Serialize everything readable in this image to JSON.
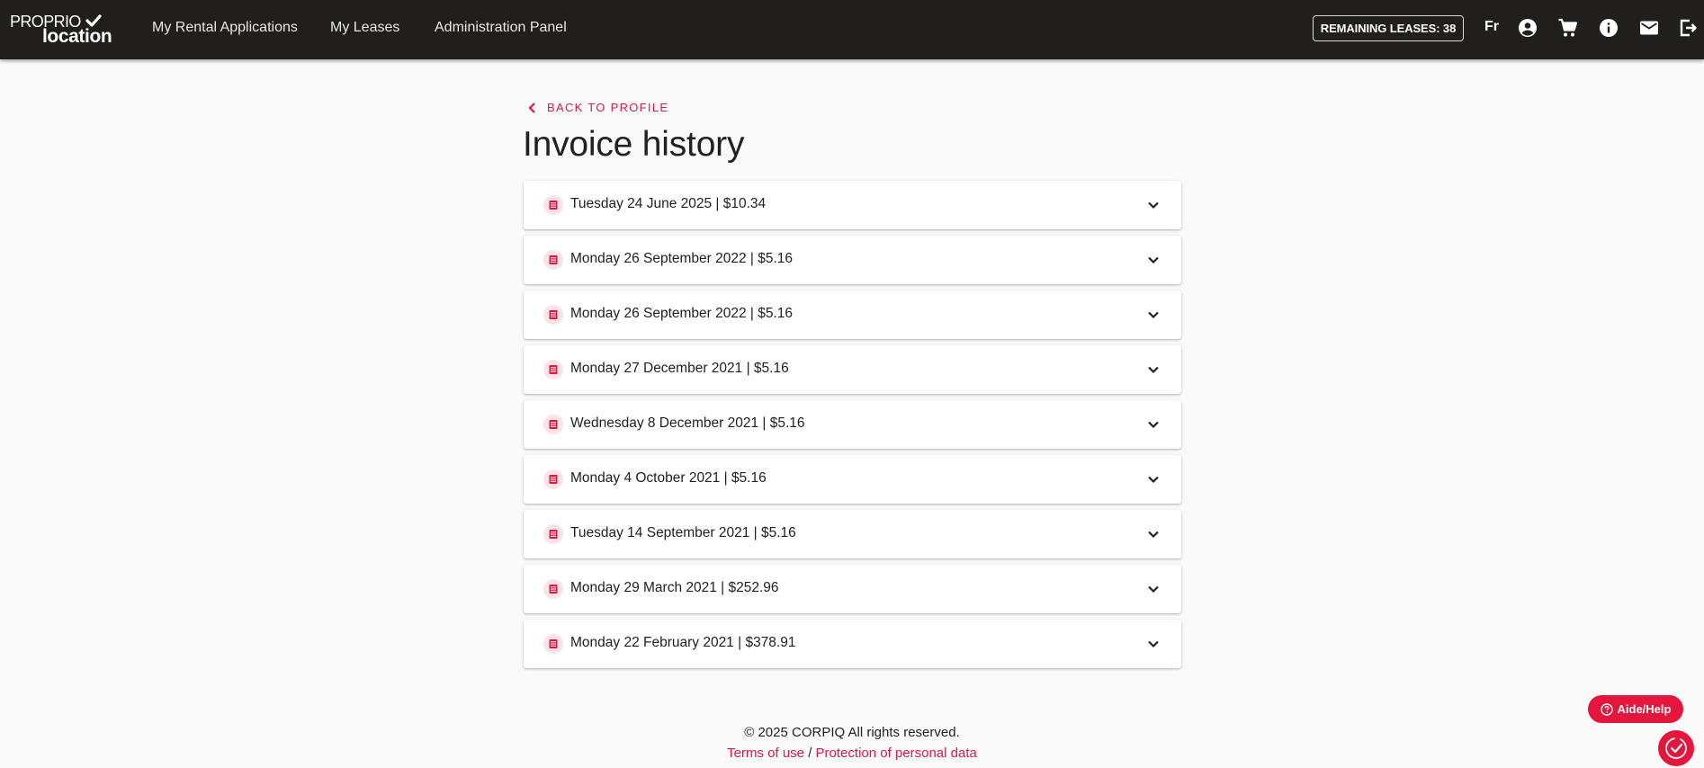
{
  "app": {
    "logo_top": "PROPRIO",
    "logo_bottom": "location"
  },
  "nav": {
    "links": [
      "My Rental Applications",
      "My Leases",
      "Administration Panel"
    ],
    "remaining_leases": "REMAINING LEASES: 38",
    "language": "Fr",
    "icons": [
      "account-circle-icon",
      "cart-icon",
      "info-icon",
      "mail-icon",
      "logout-icon"
    ]
  },
  "page": {
    "back_label": "BACK TO PROFILE",
    "title": "Invoice history"
  },
  "invoices": [
    "Tuesday 24 June 2025 | $10.34",
    "Monday 26 September 2022 | $5.16",
    "Monday 26 September 2022 | $5.16",
    "Monday 27 December 2021 | $5.16",
    "Wednesday 8 December 2021 | $5.16",
    "Monday 4 October 2021 | $5.16",
    "Tuesday 14 September 2021 | $5.16",
    "Monday 29 March 2021 | $252.96",
    "Monday 22 February 2021 | $378.91"
  ],
  "footer": {
    "copyright": "© 2025 CORPIQ All rights reserved.",
    "terms": "Terms of use",
    "separator": "/",
    "privacy": "Protection of personal data"
  },
  "help": {
    "label": "Aide/Help"
  },
  "colors": {
    "topbar": "#211f1e",
    "accent": "#d81b45",
    "help_button": "#e4163d"
  }
}
